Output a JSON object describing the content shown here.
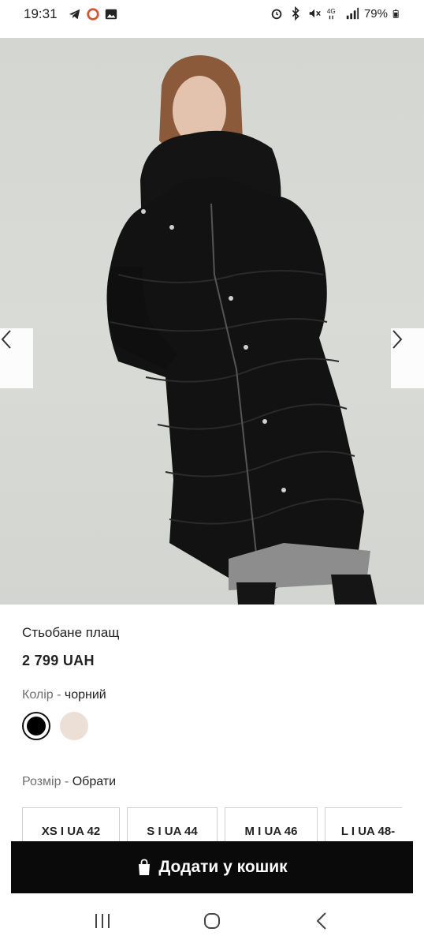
{
  "status_bar": {
    "time": "19:31",
    "battery": "79%",
    "left_icons": [
      "telegram-icon",
      "record-icon",
      "gallery-icon"
    ],
    "right_icons": [
      "alarm-icon",
      "bluetooth-icon",
      "mute-icon",
      "4g-icon",
      "signal-icon",
      "battery-icon"
    ]
  },
  "product": {
    "title": "Стьобане плащ",
    "price": "2 799 UAH",
    "color_label": "Колір",
    "color_separator": " - ",
    "color_value": "чорний",
    "swatches": [
      {
        "name": "black",
        "color": "#000000",
        "selected": true
      },
      {
        "name": "beige",
        "color": "#ecdfd6",
        "selected": false
      }
    ],
    "size_label": "Розмір",
    "size_separator": " - ",
    "size_value": "Обрати",
    "sizes": [
      "XS I UA 42",
      "S I UA 44",
      "M I UA 46",
      "L I UA 48-"
    ]
  },
  "cart": {
    "label": "Додати у кошик"
  },
  "colors": {
    "button_bg": "#0a0a0a",
    "image_bg": "#d6d8d4"
  }
}
